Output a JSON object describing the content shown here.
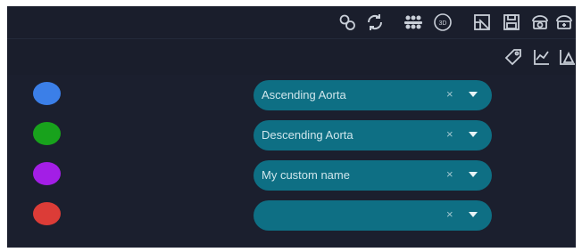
{
  "toolbar": {
    "row1_icons": [
      {
        "name": "link-icon"
      },
      {
        "name": "refresh-icon"
      },
      {
        "name": "group-icon"
      },
      {
        "name": "eye-360-icon"
      },
      {
        "name": "crop-icon"
      },
      {
        "name": "save-icon"
      },
      {
        "name": "camera-icon"
      },
      {
        "name": "camera-rotate-icon"
      }
    ],
    "row2_icons": [
      {
        "name": "tag-icon"
      },
      {
        "name": "line-chart-icon"
      },
      {
        "name": "area-chart-icon"
      }
    ]
  },
  "segments": [
    {
      "color": "#3b7fe8",
      "label": "Ascending Aorta",
      "clear": "×"
    },
    {
      "color": "#18a21c",
      "label": "Descending Aorta",
      "clear": "×"
    },
    {
      "color": "#a31ee6",
      "label": "My custom name",
      "clear": "×"
    },
    {
      "color": "#dc3c37",
      "label": "",
      "clear": "×"
    }
  ]
}
